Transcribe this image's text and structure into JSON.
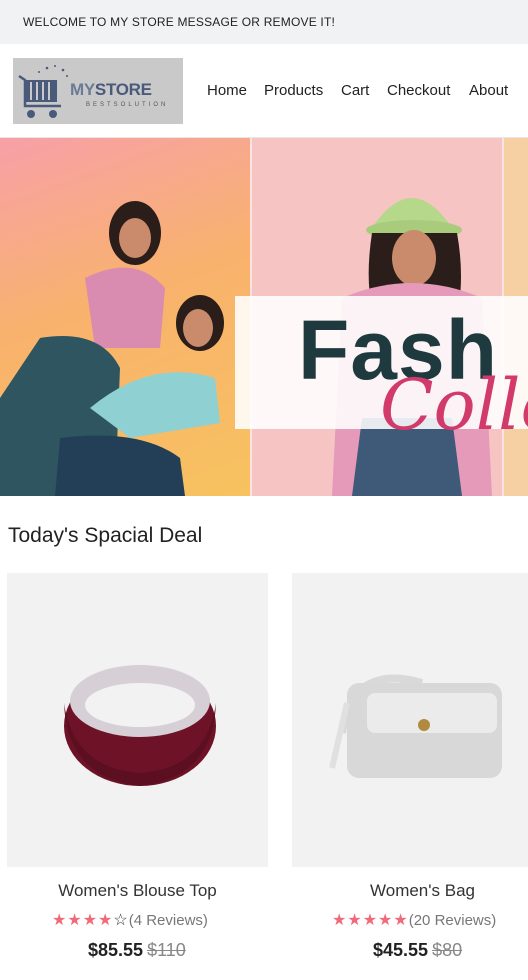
{
  "topbar": {
    "message": "WELCOME TO MY STORE MESSAGE OR REMOVE IT!"
  },
  "logo": {
    "word1": "MY",
    "word2": "STORE",
    "tagline": "BESTSOLUTION"
  },
  "nav": [
    "Home",
    "Products",
    "Cart",
    "Checkout",
    "About"
  ],
  "hero": {
    "headline": "Fash",
    "script": "Colle"
  },
  "section": {
    "title": "Today's Spacial Deal"
  },
  "products": [
    {
      "name": "Women's Blouse Top",
      "stars_full": "★★★★",
      "stars_empty": "☆",
      "reviews": "(4 Reviews)",
      "price": "$85.55",
      "old_price": "$110"
    },
    {
      "name": "Women's Bag",
      "stars_full": "★★★★★",
      "stars_empty": "",
      "reviews": "(20 Reviews)",
      "price": "$45.55",
      "old_price": "$80"
    }
  ]
}
